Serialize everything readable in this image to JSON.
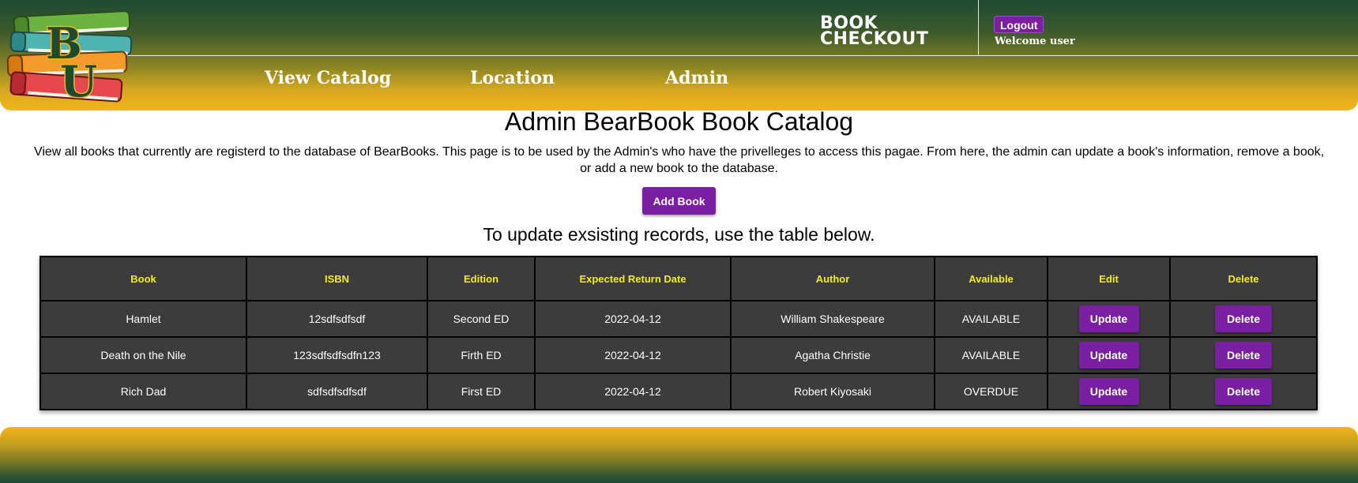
{
  "header": {
    "brand_line1": "BOOK",
    "brand_line2": "CHECKOUT",
    "logout_label": "Logout",
    "welcome_text": "Welcome user",
    "logo_icon": "books-stack-bu-logo",
    "logo_letters": "BU",
    "nav": [
      {
        "label": "View Catalog"
      },
      {
        "label": "Location"
      },
      {
        "label": "Admin"
      }
    ]
  },
  "main": {
    "title": "Admin BearBook Book Catalog",
    "description": "View all books that currently are registerd to the database of BearBooks. This page is to be used by the Admin's who have the privelleges to access this pagae. From here, the admin can update a book's information, remove a book, or add a new book to the database.",
    "add_book_label": "Add Book",
    "subtitle": "To update exsisting records, use the table below."
  },
  "table": {
    "headers": [
      "Book",
      "ISBN",
      "Edition",
      "Expected Return Date",
      "Author",
      "Available",
      "Edit",
      "Delete"
    ],
    "update_label": "Update",
    "delete_label": "Delete",
    "rows": [
      {
        "book": "Hamlet",
        "isbn": "12sdfsdfsdf",
        "edition": "Second ED",
        "return_date": "2022-04-12",
        "author": "William Shakespeare",
        "available": "AVAILABLE"
      },
      {
        "book": "Death on the Nile",
        "isbn": "123sdfsdfsdfn123",
        "edition": "Firth ED",
        "return_date": "2022-04-12",
        "author": "Agatha Christie",
        "available": "AVAILABLE"
      },
      {
        "book": "Rich Dad",
        "isbn": "sdfsdfsdfsdf",
        "edition": "First ED",
        "return_date": "2022-04-12",
        "author": "Robert Kiyosaki",
        "available": "OVERDUE"
      }
    ]
  },
  "colors": {
    "accent_purple": "#7b1fa2",
    "header_green": "#1d4a32",
    "header_gold": "#f2b417",
    "table_bg": "#3c3c3c",
    "table_header_text": "#f2ee14"
  }
}
